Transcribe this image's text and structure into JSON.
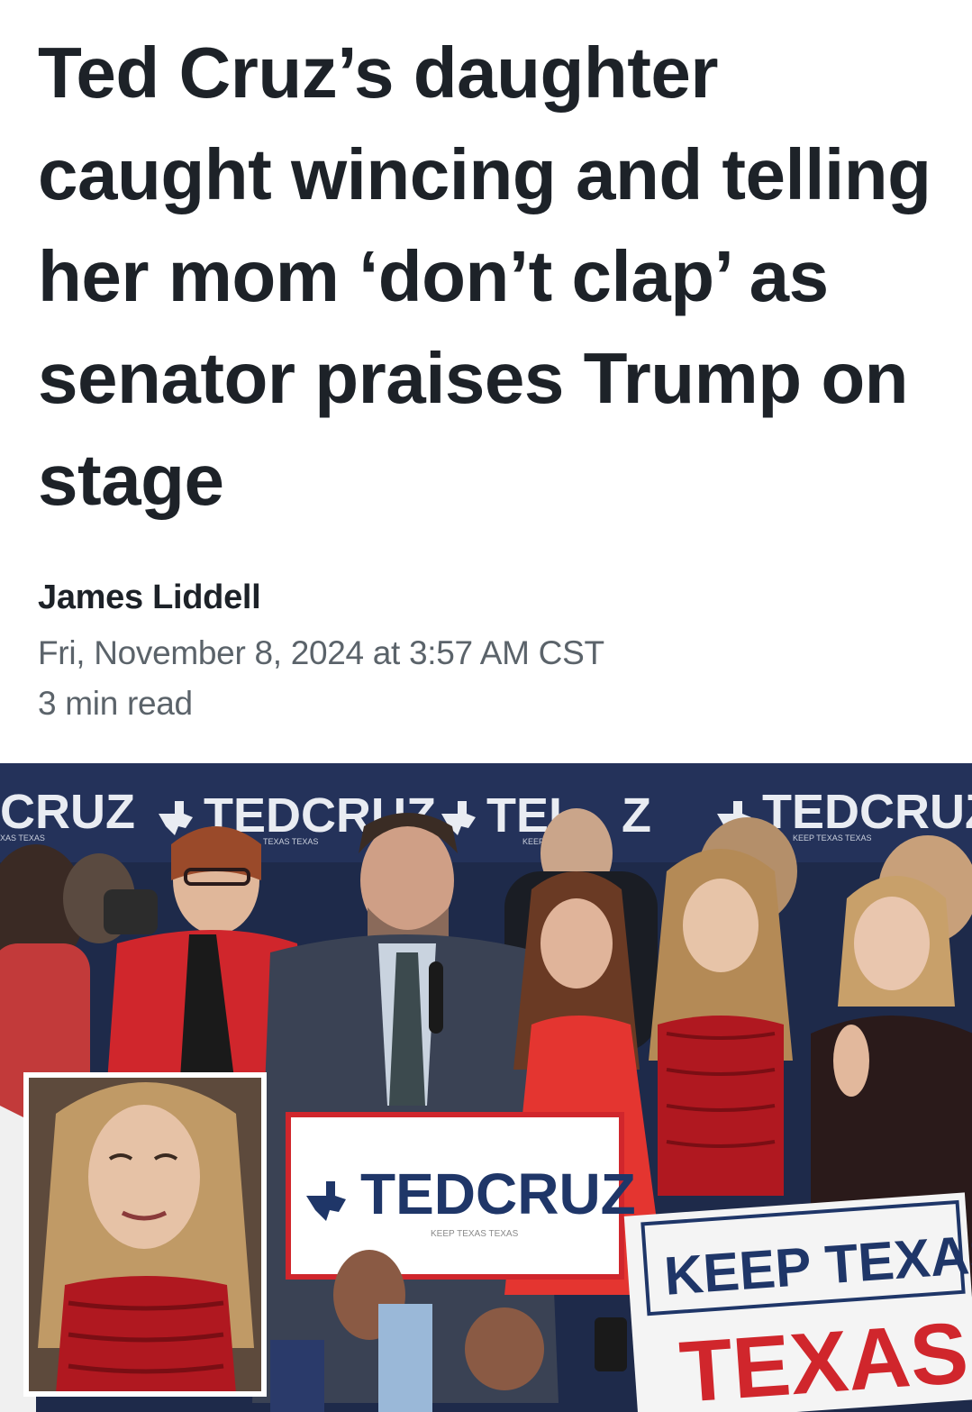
{
  "article": {
    "headline": "Ted Cruz’s daughter caught wincing and telling her mom ‘don’t clap’ as senator praises Trump on stage",
    "author": "James Liddell",
    "date": "Fri, November 8, 2024 at 3:57 AM CST",
    "read_time": "3 min read"
  },
  "photo": {
    "backdrop_logos": [
      "CRUZ",
      "TEDCRUZ",
      "TEI",
      "Z",
      "TEDCRUZ"
    ],
    "backdrop_sublabels": [
      "XAS TEXAS",
      "TEXAS TEXAS",
      "KEEP",
      "KEEP TEXAS TEXAS"
    ],
    "podium_sign": "TEDCRUZ",
    "podium_sign_tagline": "KEEP TEXAS TEXAS",
    "crowd_sign_line1": "KEEP TEXAS",
    "crowd_sign_line2": "TEXAS",
    "colors": {
      "backdrop": "#1e2a4a",
      "red": "#c8202a",
      "sign_blue": "#1f3668"
    }
  }
}
